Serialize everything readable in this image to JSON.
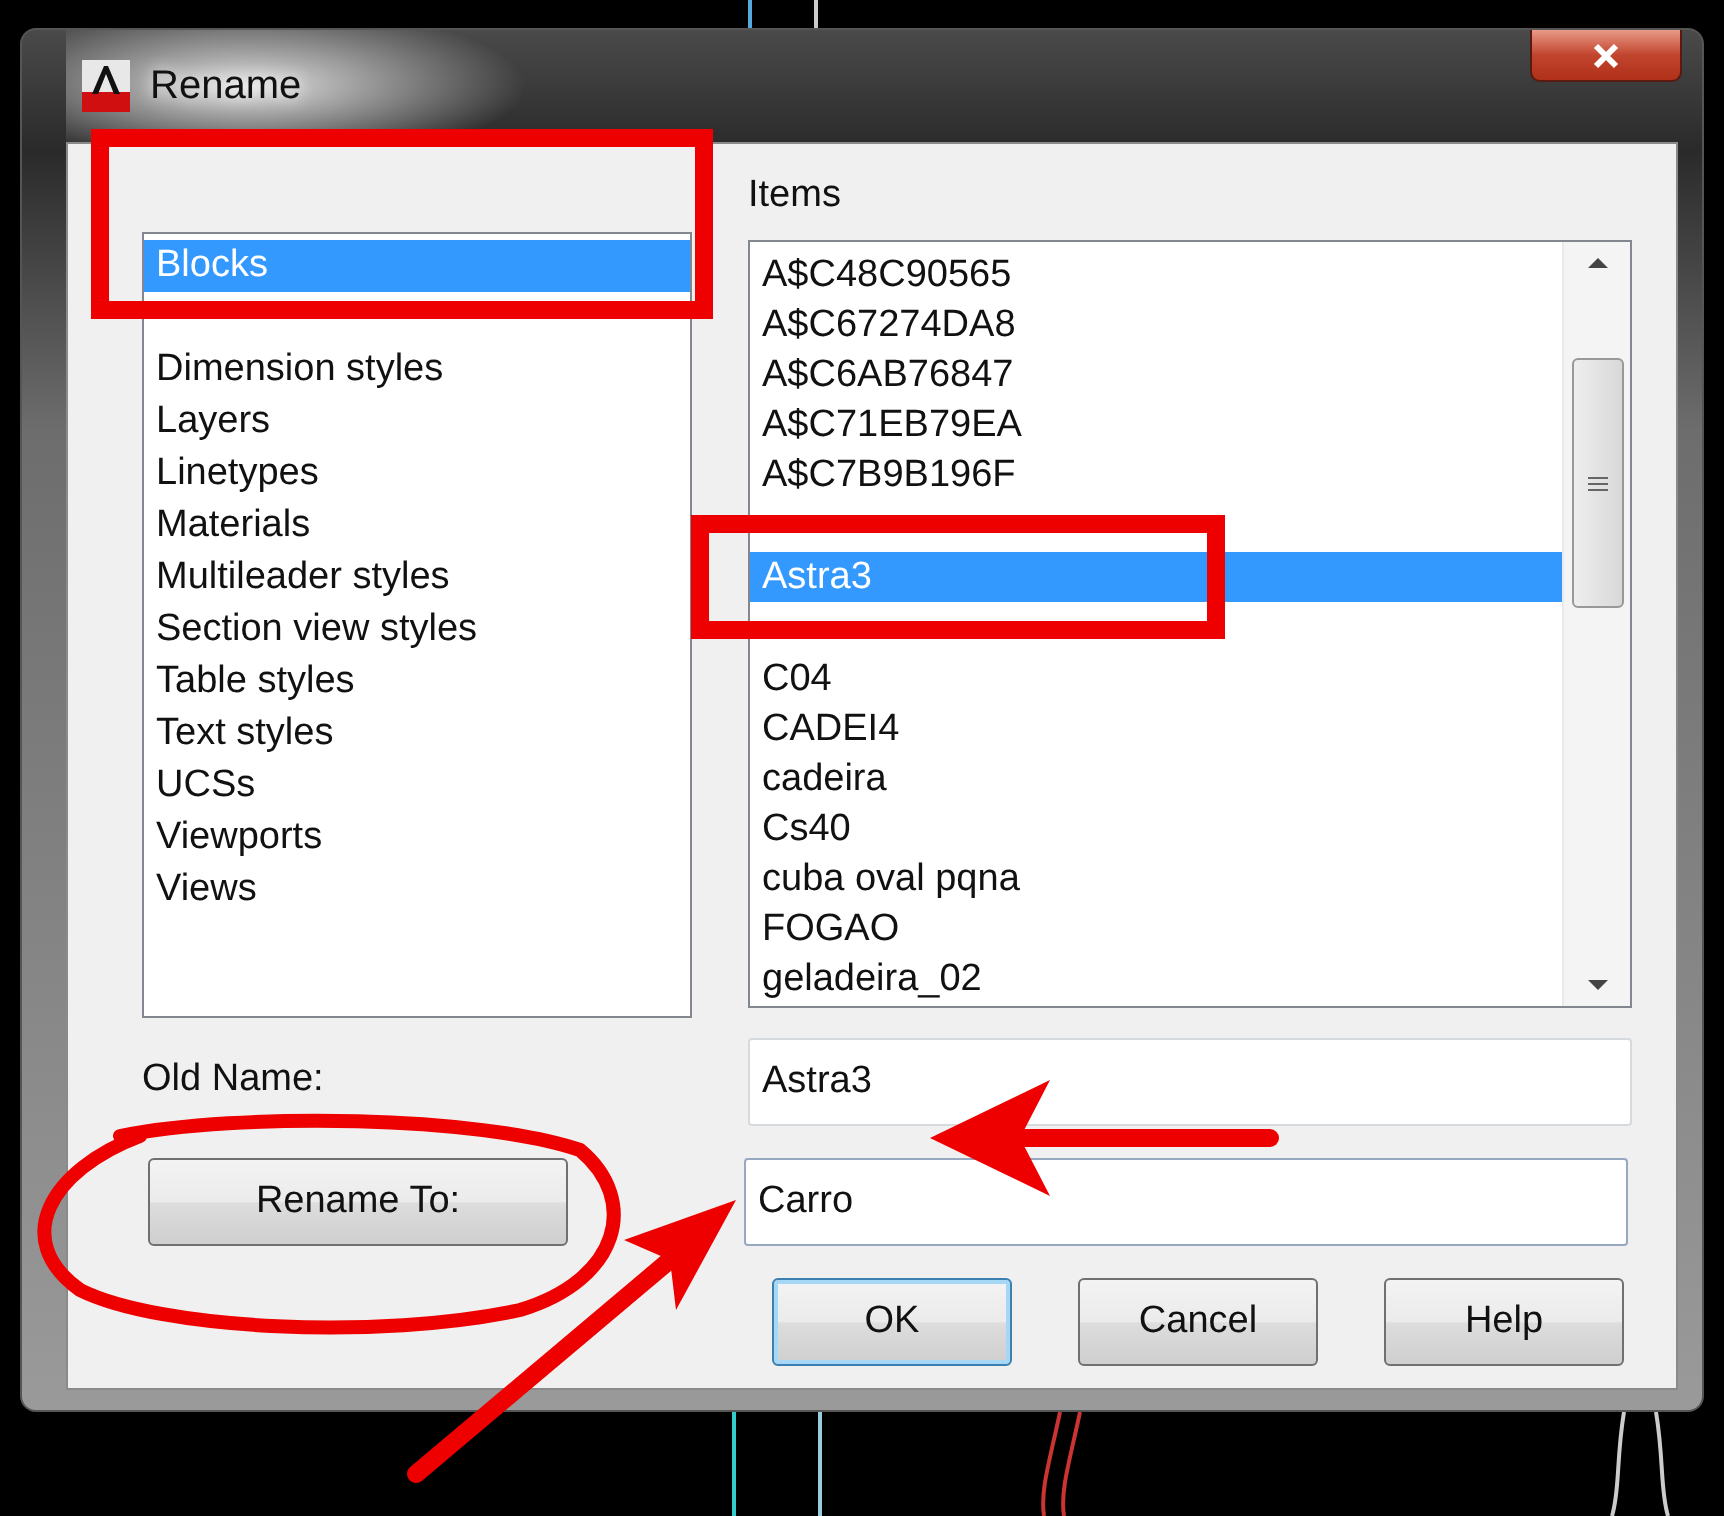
{
  "window": {
    "title": "Rename"
  },
  "named_objects": {
    "items": [
      {
        "label": "Blocks",
        "selected": true
      },
      {
        "selected": false
      },
      {
        "label": "Dimension styles",
        "selected": false
      },
      {
        "label": "Layers",
        "selected": false
      },
      {
        "label": "Linetypes",
        "selected": false
      },
      {
        "label": "Materials",
        "selected": false
      },
      {
        "label": "Multileader styles",
        "selected": false
      },
      {
        "label": "Section view styles",
        "selected": false
      },
      {
        "label": "Table styles",
        "selected": false
      },
      {
        "label": "Text styles",
        "selected": false
      },
      {
        "label": "UCSs",
        "selected": false
      },
      {
        "label": "Viewports",
        "selected": false
      },
      {
        "label": "Views",
        "selected": false
      }
    ]
  },
  "items": {
    "label": "Items",
    "items": [
      {
        "label": "A$C48C90565",
        "selected": false
      },
      {
        "label": "A$C67274DA8",
        "selected": false
      },
      {
        "label": "A$C6AB76847",
        "selected": false
      },
      {
        "label": "A$C71EB79EA",
        "selected": false
      },
      {
        "label": "A$C7B9B196F",
        "selected": false
      },
      {
        "selected": false
      },
      {
        "label": "Astra3",
        "selected": true
      },
      {
        "selected": false
      },
      {
        "label": "C04",
        "selected": false
      },
      {
        "label": "CADEI4",
        "selected": false
      },
      {
        "label": "cadeira",
        "selected": false
      },
      {
        "label": "Cs40",
        "selected": false
      },
      {
        "label": "cuba oval pqna",
        "selected": false
      },
      {
        "label": "FOGAO",
        "selected": false
      },
      {
        "label": "geladeira_02",
        "selected": false
      }
    ]
  },
  "old_name": {
    "label": "Old Name:",
    "value": "Astra3"
  },
  "rename_to": {
    "button": "Rename To:",
    "value": "Carro"
  },
  "buttons": [
    {
      "label": "OK",
      "default": true
    },
    {
      "label": "Cancel",
      "default": false
    },
    {
      "label": "Help",
      "default": false
    }
  ]
}
